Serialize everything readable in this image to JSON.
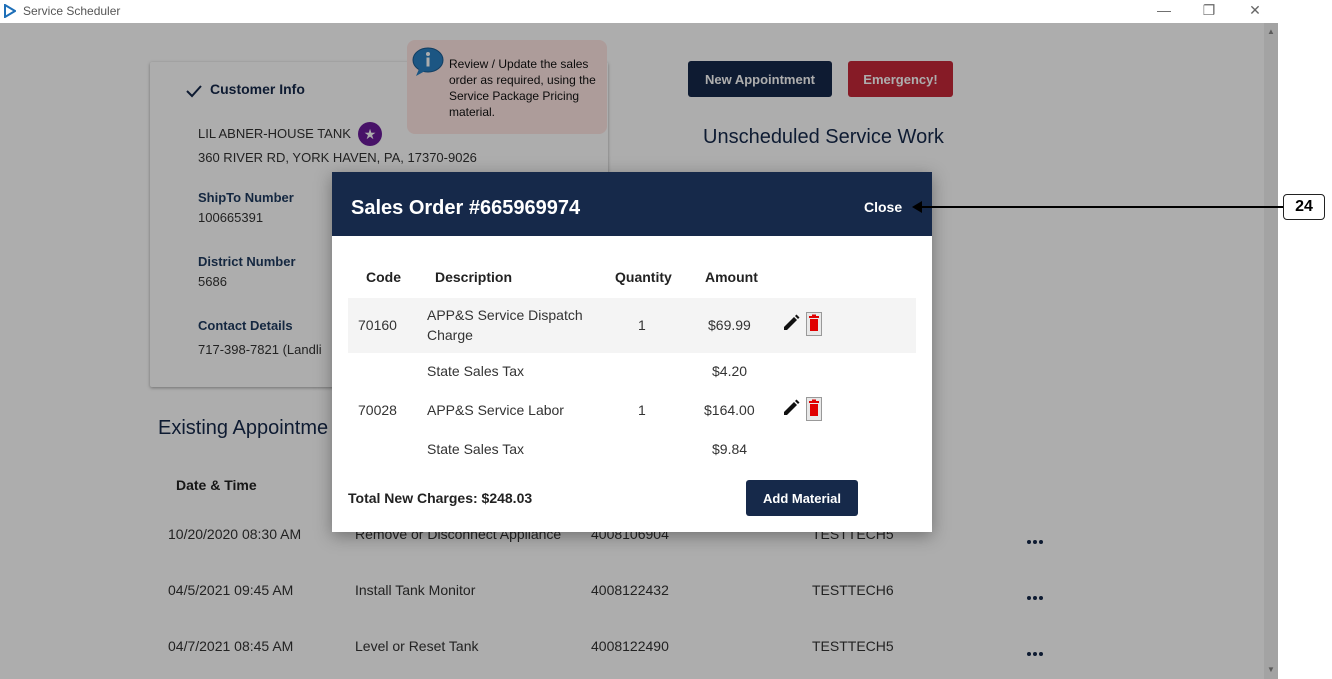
{
  "window": {
    "title": "Service Scheduler"
  },
  "tooltip": {
    "text": "Review / Update the sales order as required, using the Service Package Pricing material."
  },
  "customer_info": {
    "heading": "Customer Info",
    "name": "LIL ABNER-HOUSE TANK",
    "address": "360 RIVER RD, YORK HAVEN, PA, 17370-9026",
    "shipto_label": "ShipTo Number",
    "shipto_value": "100665391",
    "district_label": "District Number",
    "district_value": "5686",
    "contact_label": "Contact Details",
    "contact_value": "717-398-7821 (Landli"
  },
  "actions": {
    "new_appointment": "New Appointment",
    "emergency": "Emergency!"
  },
  "unscheduled_heading": "Unscheduled Service Work",
  "existing": {
    "heading": "Existing Appointme",
    "col_date": "Date & Time",
    "rows": [
      {
        "date": "10/20/2020 08:30 AM",
        "desc": "Remove or Disconnect Appliance",
        "order": "4008106904",
        "tech": "TESTTECH5"
      },
      {
        "date": "04/5/2021 09:45 AM",
        "desc": "Install Tank Monitor",
        "order": "4008122432",
        "tech": "TESTTECH6"
      },
      {
        "date": "04/7/2021 08:45 AM",
        "desc": "Level or Reset Tank",
        "order": "4008122490",
        "tech": "TESTTECH5"
      }
    ]
  },
  "modal": {
    "title": "Sales Order #665969974",
    "close": "Close",
    "headers": {
      "code": "Code",
      "description": "Description",
      "quantity": "Quantity",
      "amount": "Amount"
    },
    "lines": [
      {
        "code": "70160",
        "desc1": "APP&S Service Dispatch",
        "desc2": "Charge",
        "qty": "1",
        "amount": "$69.99"
      },
      {
        "desc": "State Sales Tax",
        "amount": "$4.20"
      },
      {
        "code": "70028",
        "desc": "APP&S Service Labor",
        "qty": "1",
        "amount": "$164.00"
      },
      {
        "desc": "State Sales Tax",
        "amount": "$9.84"
      }
    ],
    "total": "Total New Charges: $248.03",
    "add_material": "Add Material"
  },
  "annotation": {
    "number": "24"
  },
  "colors": {
    "navy": "#16294a",
    "red": "#c62838",
    "purple": "#6a1b9a",
    "tooltip_bg": "#ffe6e3"
  },
  "icons": [
    "app-logo-icon",
    "minimize-icon",
    "restore-icon",
    "close-window-icon",
    "checkmark-icon",
    "star-icon",
    "info-bubble-icon",
    "edit-pencil-icon",
    "trash-icon",
    "more-options-icon"
  ]
}
